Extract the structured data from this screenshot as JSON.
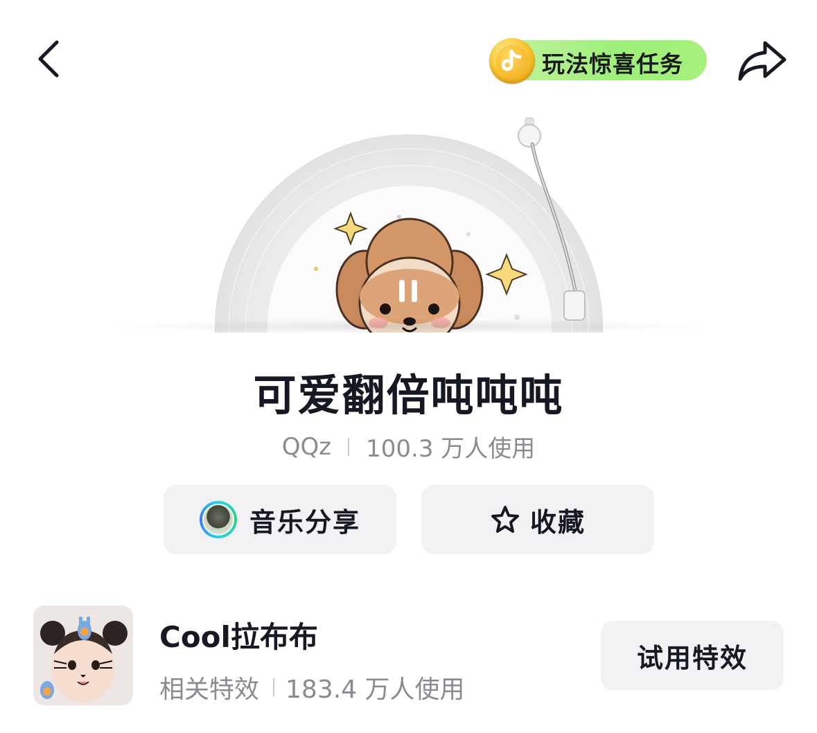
{
  "header": {
    "back_icon": "chevron-left-icon",
    "share_icon": "share-arrow-icon",
    "task_pill": {
      "label": "玩法惊喜任务",
      "icon": "music-coin-icon",
      "colors": {
        "pill": "#a6ef7f",
        "coin": "#f5b623"
      }
    }
  },
  "player": {
    "cover_icon": "poodle-illustration",
    "state_icon": "pause-icon"
  },
  "song": {
    "title": "可爱翻倍吨吨吨",
    "author": "QQz",
    "usage": "100.3 万人使用"
  },
  "actions": {
    "share_label": "音乐分享",
    "favorite_label": "收藏",
    "favorite_icon": "star-outline-icon"
  },
  "effect": {
    "name": "Cool拉布布",
    "type": "相关特效",
    "usage": "183.4 万人使用",
    "try_label": "试用特效"
  },
  "colors": {
    "text_primary": "#161823",
    "text_secondary": "#8a8b91",
    "button_bg": "#f2f2f4"
  }
}
